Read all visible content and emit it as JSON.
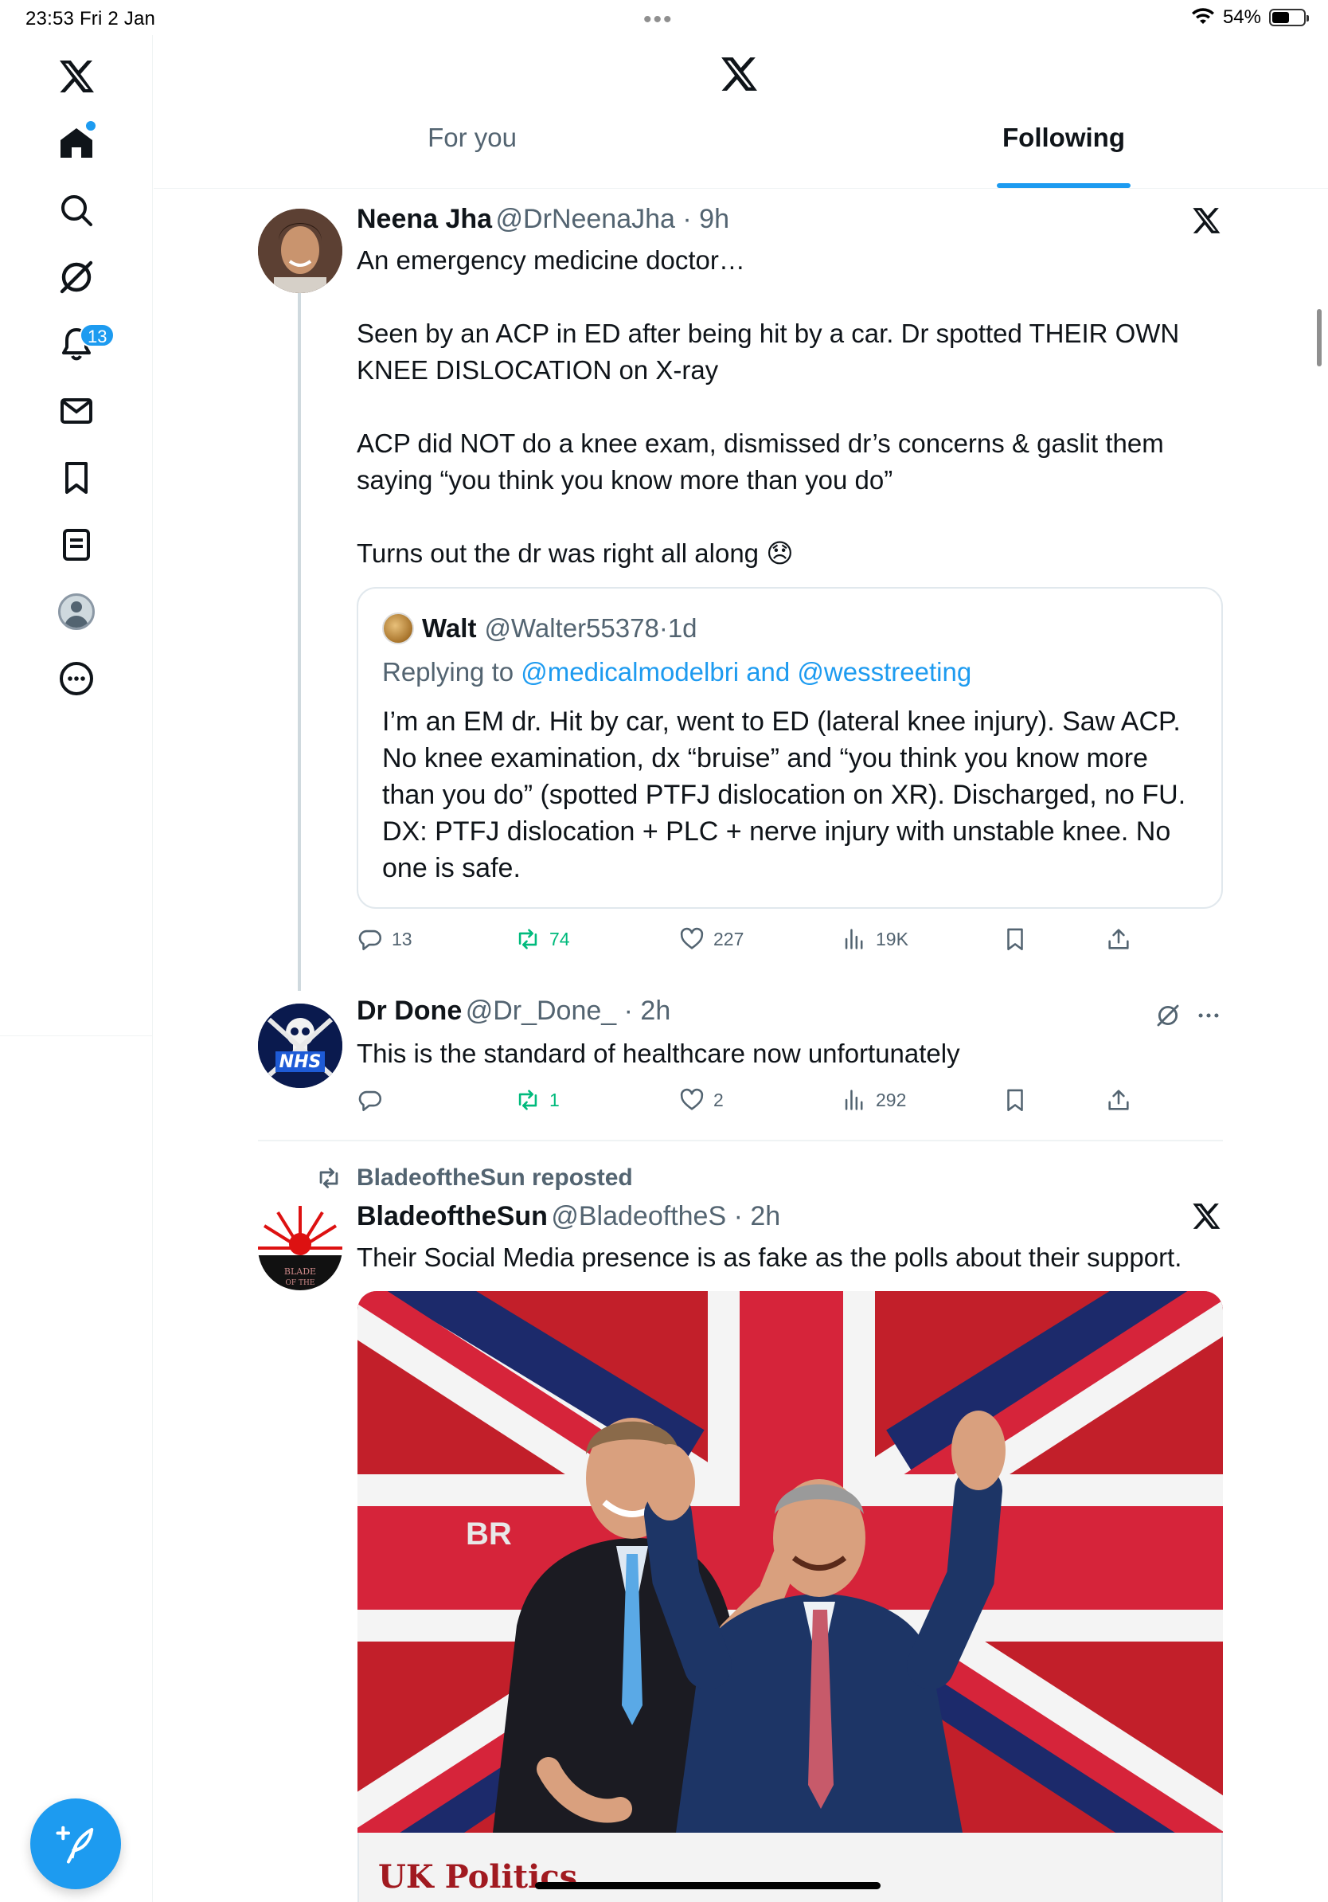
{
  "status_bar": {
    "time": "23:53",
    "date": "Fri 2 Jan",
    "battery": "54%",
    "battery_level": 0.54
  },
  "header": {
    "tabs": [
      {
        "label": "For you",
        "active": false
      },
      {
        "label": "Following",
        "active": true
      }
    ]
  },
  "sidebar": {
    "notification_count": "13"
  },
  "tweets": [
    {
      "name": "Neena Jha",
      "handle": "@DrNeenaJha",
      "time": "9h",
      "text": "An emergency medicine doctor…\n\nSeen by an ACP in ED after being hit by a car. Dr spotted THEIR OWN\nKNEE DISLOCATION on X-ray\n\nACP did NOT do a knee exam, dismissed dr’s concerns & gaslit them\nsaying “you think you know more than you do”\n\nTurns out the dr was right all along",
      "emoji": "😞",
      "quote": {
        "name": "Walt",
        "handle": "@Walter55378",
        "time": "1d",
        "replying_prefix": "Replying to ",
        "replying_to": "@medicalmodelbri and @wesstreeting",
        "text": "I’m an EM dr. Hit by car, went to ED (lateral knee injury). Saw ACP.\nNo knee examination, dx  “bruise” and “you think you know more\nthan you do” (spotted PTFJ dislocation on XR). Discharged, no FU.\nDX: PTFJ dislocation + PLC + nerve injury with unstable knee. No\none is safe."
      },
      "stats": {
        "replies": "13",
        "reposts": "74",
        "likes": "227",
        "views": "19K"
      }
    },
    {
      "name": "Dr Done",
      "handle": "@Dr_Done_",
      "time": "2h",
      "avatar_text": "NHS",
      "text": "This is the standard of healthcare now unfortunately",
      "stats": {
        "replies": "",
        "reposts": "1",
        "likes": "2",
        "views": "292"
      }
    },
    {
      "repost_label": "BladeoftheSun reposted",
      "name": "BladeoftheSun",
      "handle": "@BladeoftheS",
      "time": "2h",
      "text": "Their Social Media presence is as fake as the polls about their support.",
      "media_banner_text": "BR",
      "media_caption": "UK Politics"
    }
  ],
  "colors": {
    "accent": "#1d9bf0",
    "repost_green": "#00ba7c",
    "secondary_text": "#536471"
  },
  "icons": [
    "x-logo-icon",
    "home-icon",
    "search-icon",
    "grok-icon",
    "bell-icon",
    "mail-icon",
    "bookmark-icon",
    "lists-icon",
    "profile-icon",
    "more-icon",
    "compose-icon",
    "reply-icon",
    "repost-icon",
    "like-icon",
    "views-icon",
    "share-icon"
  ]
}
